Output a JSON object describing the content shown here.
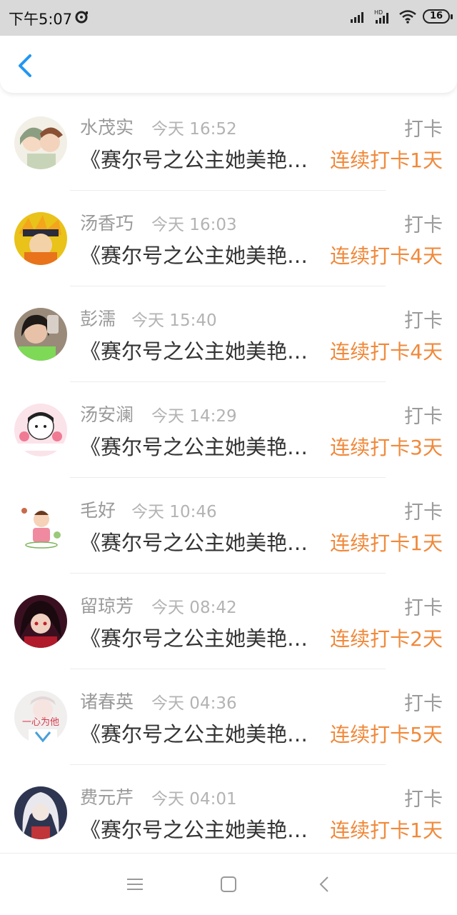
{
  "status_bar": {
    "time": "下午5:07",
    "battery": "16",
    "icons": [
      "notification-icon",
      "signal-icon",
      "hd-signal-icon",
      "wifi-icon",
      "battery-icon"
    ]
  },
  "nav": {
    "back_icon": "chevron-left-icon"
  },
  "items": [
    {
      "name": "水茂实",
      "time": "今天 16:52",
      "tag": "打卡",
      "title": "《赛尔号之公主她美艳动人》",
      "streak": "连续打卡1天"
    },
    {
      "name": "汤香巧",
      "time": "今天 16:03",
      "tag": "打卡",
      "title": "《赛尔号之公主她美艳动人》",
      "streak": "连续打卡4天"
    },
    {
      "name": "彭濡",
      "time": "今天 15:40",
      "tag": "打卡",
      "title": "《赛尔号之公主她美艳动人》",
      "streak": "连续打卡4天"
    },
    {
      "name": "汤安澜",
      "time": "今天 14:29",
      "tag": "打卡",
      "title": "《赛尔号之公主她美艳动人》",
      "streak": "连续打卡3天"
    },
    {
      "name": "毛好",
      "time": "今天 10:46",
      "tag": "打卡",
      "title": "《赛尔号之公主她美艳动人》",
      "streak": "连续打卡1天"
    },
    {
      "name": "留琼芳",
      "time": "今天 08:42",
      "tag": "打卡",
      "title": "《赛尔号之公主她美艳动人》",
      "streak": "连续打卡2天"
    },
    {
      "name": "诸春英",
      "time": "今天 04:36",
      "tag": "打卡",
      "title": "《赛尔号之公主她美艳动人》",
      "streak": "连续打卡5天"
    },
    {
      "name": "费元芹",
      "time": "今天 04:01",
      "tag": "打卡",
      "title": "《赛尔号之公主她美艳动人》",
      "streak": "连续打卡1天"
    }
  ],
  "avatar_text": {
    "item_6": "一心为他"
  },
  "colors": {
    "accent": "#f0893b",
    "back_arrow": "#2196f3",
    "status_bar_bg": "#d9d9d9"
  },
  "bottom_nav": [
    "menu-icon",
    "home-square-icon",
    "back-icon"
  ]
}
